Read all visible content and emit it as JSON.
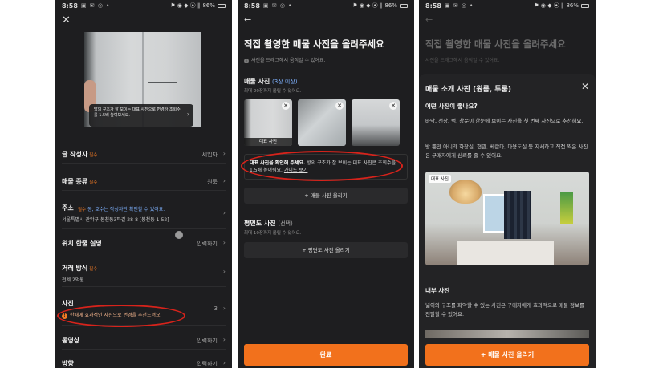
{
  "status_bar": {
    "time": "8:58",
    "left_icons": "▣ ✉ ◎ •",
    "right_icons": "⚑ ◉ ◆ ⦿ ∥",
    "battery": "86%"
  },
  "screen1": {
    "photo_tooltip": "방의 구조가 잘 보이는 대표 사진으로 변경하 조회수를 1.5배 높여보세요.",
    "rows": [
      {
        "label": "글 작성자",
        "required": "필수",
        "value": "세입자"
      },
      {
        "label": "매물 종류",
        "required": "필수",
        "value": "원룸"
      },
      {
        "label": "주소",
        "required": "",
        "sub_prefix": "필수",
        "sub_blue": "동, 호수는 작성자만 확인할 수 있어요.",
        "sub2": "서울특별시 관악구 봉천동3파길 28-8 [봉천동 1-52]"
      },
      {
        "label": "위치 한줄 설명",
        "required": "",
        "value": "입력하기"
      },
      {
        "label": "거래 방식",
        "required": "필수",
        "sub2": "전세 2억원"
      },
      {
        "label": "사진",
        "required": "",
        "value": "3",
        "warning": "한때에 효과적인 사진으로 변경을 추천드려요!"
      },
      {
        "label": "동영상",
        "required": "",
        "value": "입력하기"
      },
      {
        "label": "방향",
        "required": "",
        "value": "입력하기"
      }
    ]
  },
  "screen2": {
    "title": "직접 촬영한 매물 사진을 올려주세요",
    "hint": "사진을 드래그해서 움직일 수 있어요.",
    "photo_section": {
      "title": "매물 사진",
      "accent": "(3장 이상)",
      "sub": "최대 20장까지 올릴 수 있어요."
    },
    "thumb_tag": "대표 사진",
    "notice_bold": "대표 사진을 확인해 주세요.",
    "notice_text": "방의 구조가 잘 보이는 대표 사진은 조회수를 1.5배 높여줘요.",
    "notice_link": "가이드 보기",
    "upload_photo_button": "+ 매물 사진 올리기",
    "floor_section": {
      "title": "평면도 사진",
      "muted": "(선택)",
      "sub": "최대 10장까지 올릴 수 있어요."
    },
    "upload_floor_button": "+ 평면도 사진 올리기",
    "done_button": "완료"
  },
  "screen3": {
    "title": "직접 촬영한 매물 사진을 올려주세요",
    "hint": "사진을 드래그해서 움직일 수 있어요.",
    "sheet_title": "매물 소개 사진 (원룸, 투룸)",
    "q1": "어떤 사진이 좋나요?",
    "p1": "바닥, 천장, 벽, 창문이 한눈에 보이는 사진을 첫 번째 사진으로 추천해요.",
    "p2": "방 뿐만 아니라 화장실, 현관, 베란다, 다용도실 등 자세하고 직접 찍은 사진은 구매자에게 신뢰를 줄 수 있어요.",
    "photo_tag": "대표 사진",
    "q2": "내부 사진",
    "p3": "넓이와 구조를 파악할 수 있는 사진은 구매자에게 효과적으로 매물 정보를 전달할 수 있어요.",
    "upload_button": "+ 매물 사진 올리기"
  },
  "colors": {
    "background": "#1e1e20",
    "accent_orange": "#f2711c",
    "highlight_red": "#d8231b",
    "link_blue": "#7fb2ff"
  },
  "icons": [
    "close-icon",
    "back-arrow-icon",
    "chevron-right-icon",
    "info-icon",
    "warning-icon",
    "plus-icon",
    "remove-photo-icon",
    "battery-icon"
  ]
}
